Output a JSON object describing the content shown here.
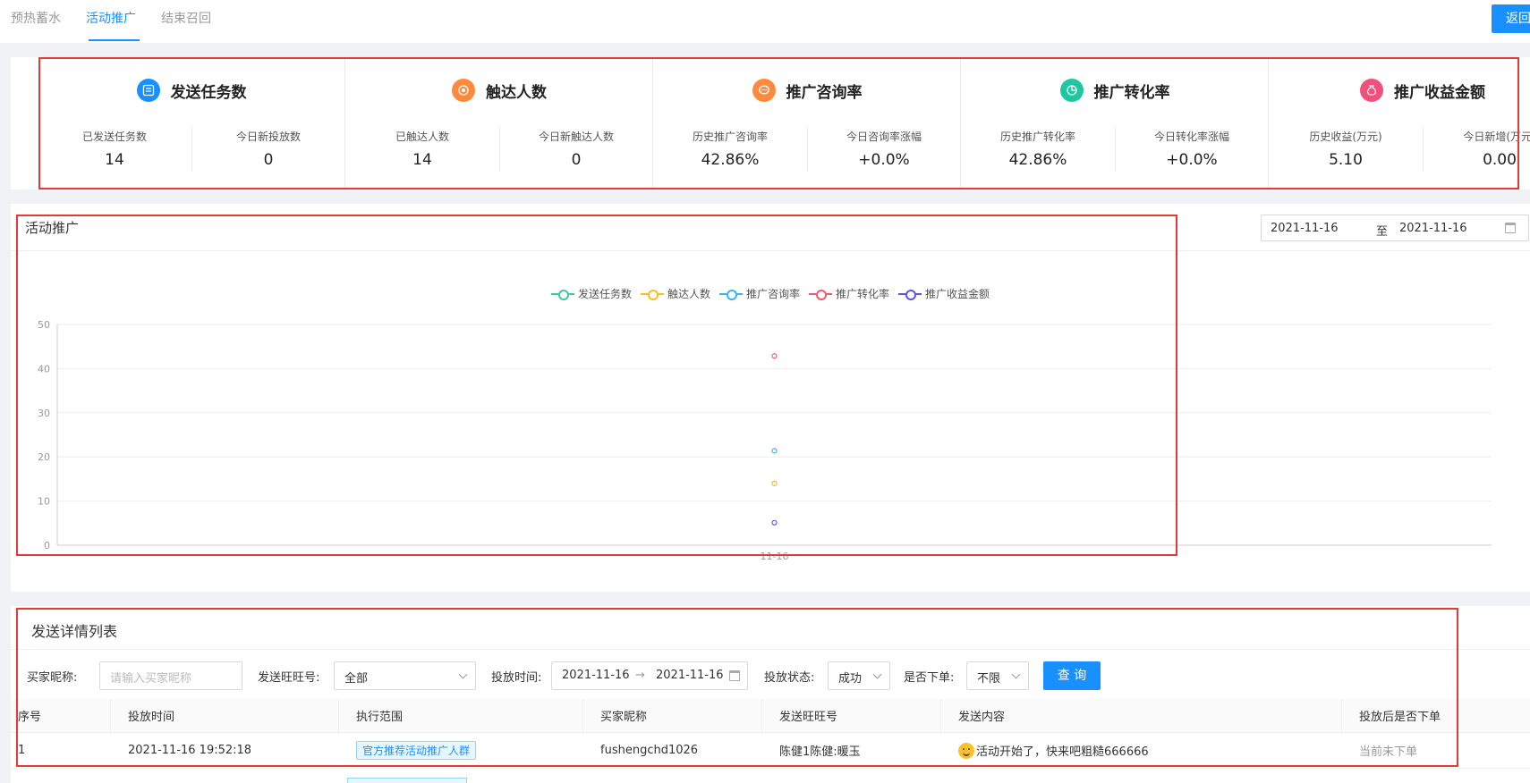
{
  "tabs": [
    {
      "label": "预热蓄水",
      "active": false
    },
    {
      "label": "活动推广",
      "active": true
    },
    {
      "label": "结束召回",
      "active": false
    }
  ],
  "back_label": "返回",
  "stats": [
    {
      "title": "发送任务数",
      "icon": "list-icon",
      "color": "#1890ff",
      "cells": [
        {
          "label": "已发送任务数",
          "value": "14"
        },
        {
          "label": "今日新投放数",
          "value": "0"
        }
      ]
    },
    {
      "title": "触达人数",
      "icon": "target-icon",
      "color": "#ff8a3d",
      "cells": [
        {
          "label": "已触达人数",
          "value": "14"
        },
        {
          "label": "今日新触达人数",
          "value": "0"
        }
      ]
    },
    {
      "title": "推广咨询率",
      "icon": "chat-icon",
      "color": "#ff8a3d",
      "cells": [
        {
          "label": "历史推广咨询率",
          "value": "42.86%"
        },
        {
          "label": "今日咨询率涨幅",
          "value": "+0.0%"
        }
      ]
    },
    {
      "title": "推广转化率",
      "icon": "pie-icon",
      "color": "#1fc7a0",
      "cells": [
        {
          "label": "历史推广转化率",
          "value": "42.86%"
        },
        {
          "label": "今日转化率涨幅",
          "value": "+0.0%"
        }
      ]
    },
    {
      "title": "推广收益金额",
      "icon": "money-bag-icon",
      "color": "#f0507a",
      "cells": [
        {
          "label": "历史收益(万元)",
          "value": "5.10"
        },
        {
          "label": "今日新增(万元)",
          "value": "0.00"
        }
      ]
    }
  ],
  "chart_section": {
    "title": "活动推广",
    "date_start": "2021-11-16",
    "date_sep": "至",
    "date_end": "2021-11-16"
  },
  "chart_data": {
    "type": "scatter",
    "x": [
      "11-16"
    ],
    "series": [
      {
        "name": "发送任务数",
        "color": "#3fc8a1",
        "values": [
          14
        ]
      },
      {
        "name": "触达人数",
        "color": "#f5c024",
        "values": [
          14
        ]
      },
      {
        "name": "推广咨询率",
        "color": "#3ab4f2",
        "values": [
          21.4
        ]
      },
      {
        "name": "推广转化率",
        "color": "#f15b6c",
        "values": [
          42.86
        ]
      },
      {
        "name": "推广收益金额",
        "color": "#5a55e6",
        "values": [
          5.1
        ]
      }
    ],
    "yticks": [
      "0",
      "10",
      "20",
      "30",
      "40",
      "50"
    ],
    "ylim": [
      0,
      50
    ],
    "legend": "top-center",
    "grid": true
  },
  "table_section": {
    "title": "发送详情列表",
    "filters": {
      "buyer_label": "买家昵称:",
      "buyer_placeholder": "请输入买家昵称",
      "wangwang_label": "发送旺旺号:",
      "wangwang_value": "全部",
      "time_label": "投放时间:",
      "time_start": "2021-11-16",
      "time_arrow": "→",
      "time_end": "2021-11-16",
      "status_label": "投放状态:",
      "status_value": "成功",
      "order_label": "是否下单:",
      "order_value": "不限",
      "query_label": "查 询"
    },
    "columns": [
      "序号",
      "投放时间",
      "执行范围",
      "买家昵称",
      "发送旺旺号",
      "发送内容",
      "投放后是否下单"
    ],
    "rows": [
      {
        "index": "1",
        "time": "2021-11-16 19:52:18",
        "scope": "官方推荐活动推广人群",
        "buyer": "fushengchd1026",
        "wangwang": "陈健1陈健:暖玉",
        "content": "活动开始了，快来吧粗糙666666",
        "ordered": "当前未下单"
      }
    ]
  }
}
